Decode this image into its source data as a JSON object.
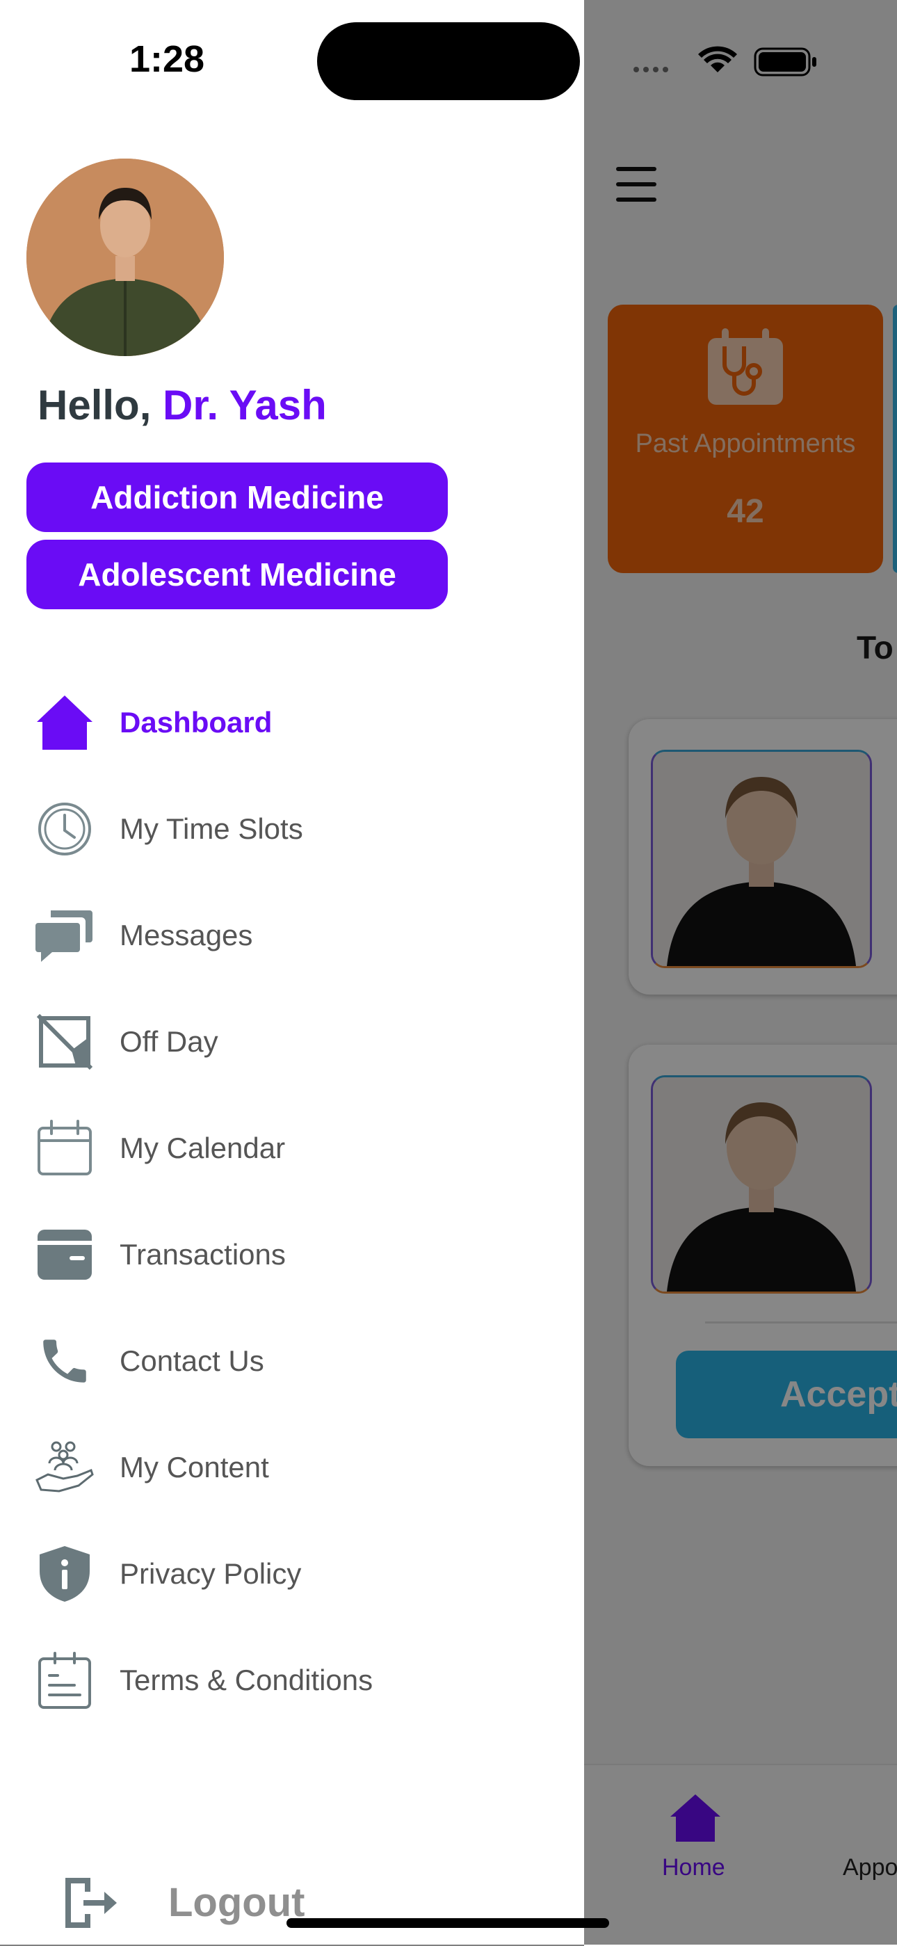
{
  "status_bar": {
    "time": "1:28"
  },
  "drawer": {
    "greeting_prefix": "Hello, ",
    "doctor_name": "Dr. Yash",
    "specialties": [
      "Addiction Medicine",
      "Adolescent Medicine"
    ],
    "menu": [
      {
        "label": "Dashboard",
        "icon": "home-icon",
        "active": true
      },
      {
        "label": "My Time Slots",
        "icon": "clock-icon"
      },
      {
        "label": "Messages",
        "icon": "chat-icon"
      },
      {
        "label": "Off Day",
        "icon": "crossed-image-icon"
      },
      {
        "label": "My Calendar",
        "icon": "calendar-icon"
      },
      {
        "label": "Transactions",
        "icon": "wallet-icon"
      },
      {
        "label": "Contact Us",
        "icon": "phone-icon"
      },
      {
        "label": "My Content",
        "icon": "people-hand-icon"
      },
      {
        "label": "Privacy Policy",
        "icon": "shield-info-icon"
      },
      {
        "label": "Terms & Conditions",
        "icon": "clipboard-icon"
      }
    ],
    "logout_label": "Logout"
  },
  "background": {
    "stat_card": {
      "label": "Past Appointments",
      "value": "42",
      "icon": "medical-calendar-icon"
    },
    "section_title": "To",
    "accept_label": "Accept",
    "bottom_nav": {
      "home_label": "Home",
      "appointments_label": "Appo"
    }
  },
  "colors": {
    "accent": "#6a0cf5",
    "stat_card": "#f2650a",
    "accept": "#2bb4e6",
    "menu_text": "#555555"
  }
}
